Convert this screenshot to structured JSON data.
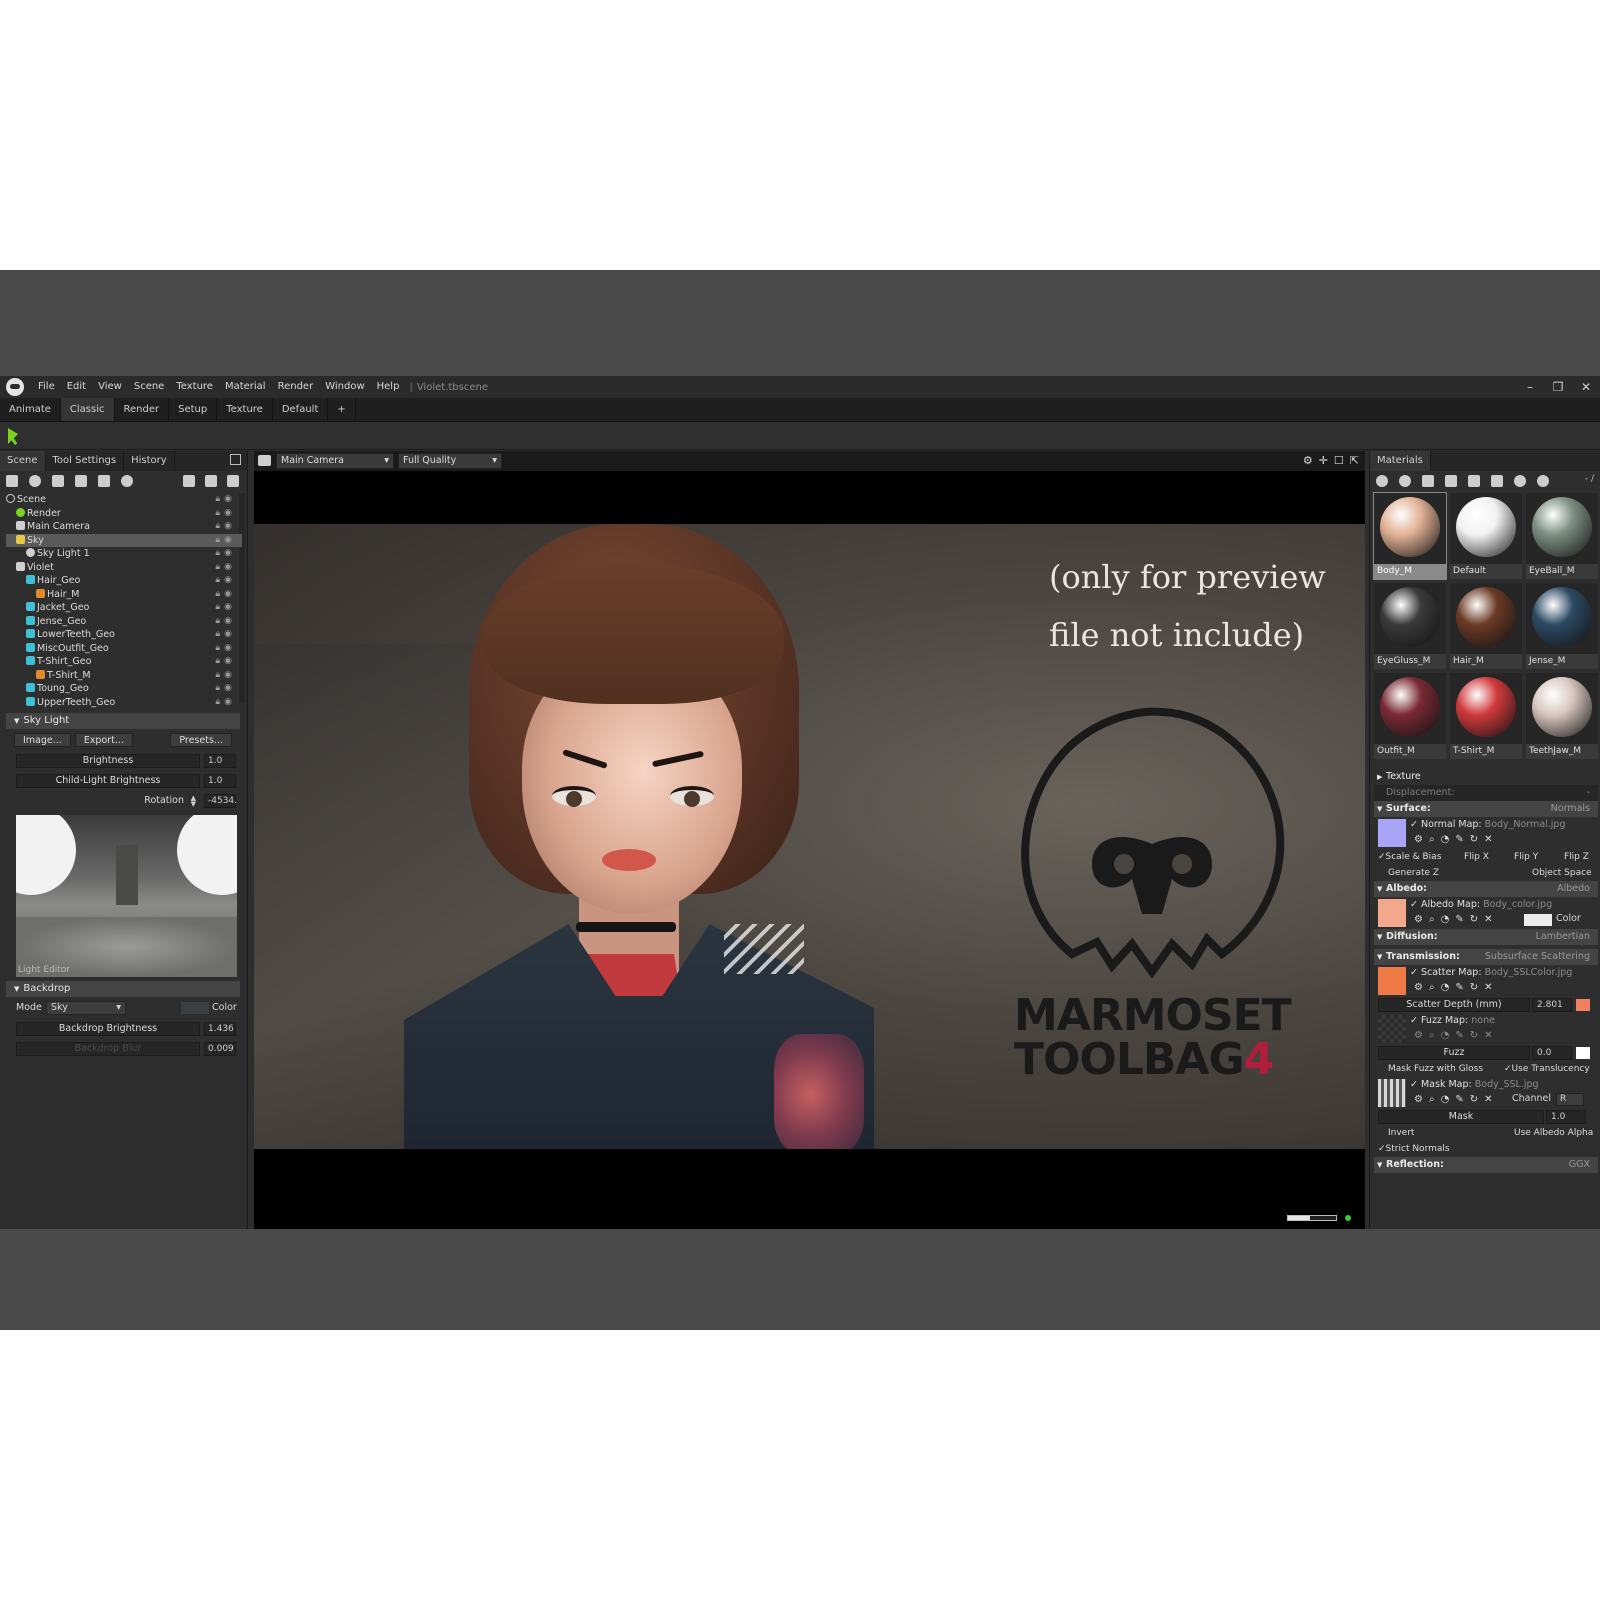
{
  "app": {
    "menu": [
      "File",
      "Edit",
      "View",
      "Scene",
      "Texture",
      "Material",
      "Render",
      "Window",
      "Help"
    ],
    "separator": "|",
    "document_title": "Violet.tbscene",
    "window_controls": [
      "–",
      "❐",
      "✕"
    ]
  },
  "workspace_tabs": [
    "Animate",
    "Classic",
    "Render",
    "Setup",
    "Texture",
    "Default",
    "+"
  ],
  "active_workspace": "Classic",
  "left_panel": {
    "tabs": [
      "Scene",
      "Tool Settings",
      "History"
    ],
    "tree": [
      {
        "label": "Scene",
        "icon": "scene",
        "indent": 0
      },
      {
        "label": "Render",
        "icon": "rend",
        "indent": 1
      },
      {
        "label": "Main Camera",
        "icon": "cam",
        "indent": 1
      },
      {
        "label": "Sky",
        "icon": "sky",
        "indent": 1
      },
      {
        "label": "Sky Light 1",
        "icon": "light",
        "indent": 2
      },
      {
        "label": "Violet",
        "icon": "grp",
        "indent": 1
      },
      {
        "label": "Hair_Geo",
        "icon": "cube",
        "indent": 2
      },
      {
        "label": "Hair_M",
        "icon": "mat",
        "indent": 3
      },
      {
        "label": "Jacket_Geo",
        "icon": "cube",
        "indent": 2
      },
      {
        "label": "Jense_Geo",
        "icon": "cube",
        "indent": 2
      },
      {
        "label": "LowerTeeth_Geo",
        "icon": "cube",
        "indent": 2
      },
      {
        "label": "MiscOutfit_Geo",
        "icon": "cube",
        "indent": 2
      },
      {
        "label": "T-Shirt_Geo",
        "icon": "cube",
        "indent": 2
      },
      {
        "label": "T-Shirt_M",
        "icon": "mat",
        "indent": 3
      },
      {
        "label": "Toung_Geo",
        "icon": "cube",
        "indent": 2
      },
      {
        "label": "UpperTeeth_Geo",
        "icon": "cube",
        "indent": 2
      }
    ],
    "selected_tree_item": "Sky",
    "sky_light": {
      "header": "Sky Light",
      "buttons": [
        "Image...",
        "Export...",
        "Presets..."
      ],
      "brightness_label": "Brightness",
      "brightness_value": "1.0",
      "child_brightness_label": "Child-Light Brightness",
      "child_brightness_value": "1.0",
      "rotation_label": "Rotation",
      "rotation_value": "-4534.",
      "pano_label": "Light Editor"
    },
    "backdrop": {
      "header": "Backdrop",
      "mode_label": "Mode",
      "mode_value": "Sky",
      "color_label": "Color",
      "brightness_label": "Backdrop Brightness",
      "brightness_value": "1.436",
      "blur_label": "Backdrop Blur",
      "blur_value": "0.009"
    }
  },
  "viewport": {
    "camera": "Main Camera",
    "quality": "Full Quality",
    "preview_note_line1": "(only for preview",
    "preview_note_line2": "file not include)",
    "brand_line1": "MARMOSET",
    "brand_line2": "TOOLBAG",
    "brand_version": "4",
    "progress_fraction": 0.45
  },
  "right_panel": {
    "tab": "Materials",
    "counter": "- /",
    "materials": [
      {
        "name": "Body_M",
        "color": "#e2b296",
        "selected": true
      },
      {
        "name": "Default",
        "color": "#f2f2f2",
        "selected": false
      },
      {
        "name": "EyeBall_M",
        "color": "#7d8f83",
        "selected": false
      },
      {
        "name": "EyeGluss_M",
        "color": "#3a3a3a",
        "selected": false
      },
      {
        "name": "Hair_M",
        "color": "#6b3a25",
        "selected": false
      },
      {
        "name": "Jense_M",
        "color": "#2c4a63",
        "selected": false
      },
      {
        "name": "Outfit_M",
        "color": "#7a2a35",
        "selected": false
      },
      {
        "name": "T-Shirt_M",
        "color": "#d03a3c",
        "selected": false
      },
      {
        "name": "TeethJaw_M",
        "color": "#d9c7c0",
        "selected": false
      }
    ],
    "texture_header": "Texture",
    "displacement": "Displacement:",
    "displacement_value": "-",
    "surface": {
      "header": "Surface:",
      "mode": "Normals",
      "map_label": "Normal Map:",
      "map_file": "Body_Normal.jpg",
      "map_color": "#a9a4f6",
      "scale_bias": "Scale & Bias",
      "flip_x": "Flip X",
      "flip_y": "Flip Y",
      "flip_z": "Flip Z",
      "generate_z": "Generate Z",
      "object_space": "Object Space"
    },
    "albedo": {
      "header": "Albedo:",
      "mode": "Albedo",
      "map_label": "Albedo Map:",
      "map_file": "Body_color.jpg",
      "map_color": "#f2a88a",
      "color_label": "Color"
    },
    "diffusion": {
      "header": "Diffusion:",
      "mode": "Lambertian"
    },
    "transmission": {
      "header": "Transmission:",
      "mode": "Subsurface Scattering",
      "scatter_label": "Scatter Map:",
      "scatter_file": "Body_SSLColor.jpg",
      "scatter_color": "#f07a45",
      "depth_label": "Scatter Depth (mm)",
      "depth_value": "2.801",
      "depth_color": "#f08060",
      "fuzz_map_label": "Fuzz Map:",
      "fuzz_map_file": "none",
      "fuzz_label": "Fuzz",
      "fuzz_value": "0.0",
      "mask_fuzz": "Mask Fuzz with Gloss",
      "use_translucency": "Use Translucency",
      "mask_map_label": "Mask Map:",
      "mask_map_file": "Body_SSL.jpg",
      "channel_label": "Channel",
      "channel_value": "R",
      "mask_label": "Mask",
      "mask_value": "1.0",
      "invert": "Invert",
      "use_albedo_alpha": "Use Albedo Alpha",
      "strict_normals": "Strict Normals"
    },
    "reflection": {
      "header": "Reflection:",
      "mode": "GGX"
    }
  }
}
